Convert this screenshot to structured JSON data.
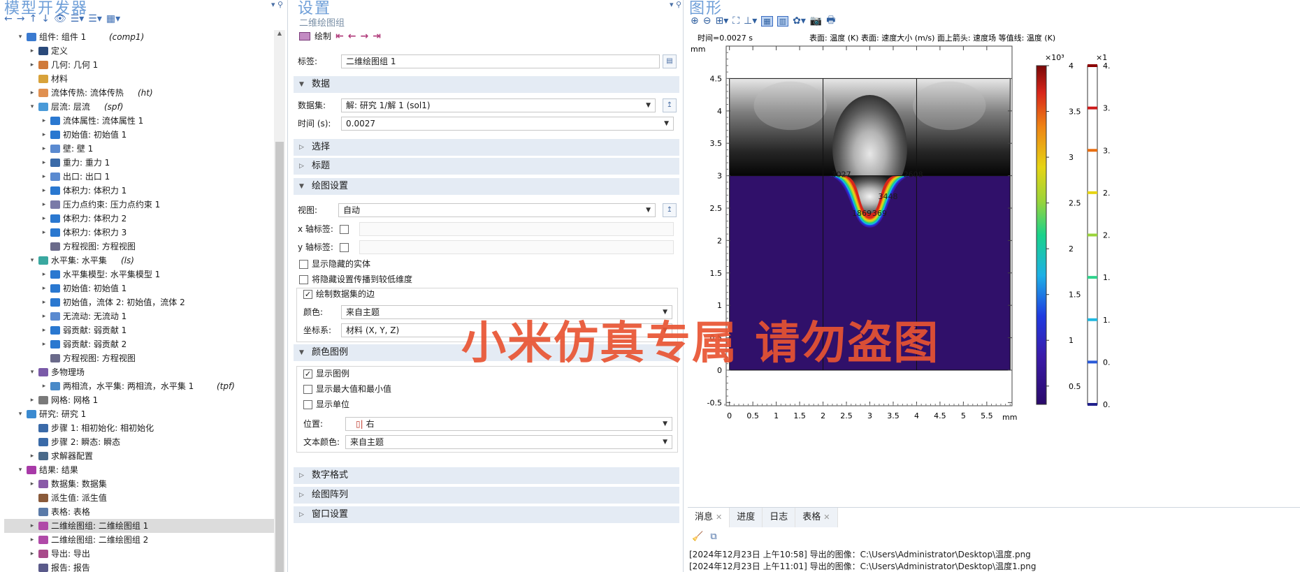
{
  "left": {
    "title": "模型开发器",
    "tree": [
      {
        "indent": 0,
        "arrow": "▾",
        "icon": "component",
        "text": "组件: 组件 1",
        "italic": "(comp1)"
      },
      {
        "indent": 1,
        "arrow": "▸",
        "icon": "definitions",
        "text": "定义",
        "italic": ""
      },
      {
        "indent": 1,
        "arrow": "▸",
        "icon": "geometry",
        "text": "几何: 几何 1",
        "italic": ""
      },
      {
        "indent": 1,
        "arrow": "",
        "icon": "materials",
        "text": "材料",
        "italic": ""
      },
      {
        "indent": 1,
        "arrow": "▸",
        "icon": "heat-transfer",
        "text": "流体传热: 流体传热",
        "italic": "(ht)"
      },
      {
        "indent": 1,
        "arrow": "▾",
        "icon": "laminar-flow",
        "text": "层流: 层流",
        "italic": "(spf)"
      },
      {
        "indent": 2,
        "arrow": "▸",
        "icon": "node-blue",
        "text": "流体属性: 流体属性 1",
        "italic": ""
      },
      {
        "indent": 2,
        "arrow": "▸",
        "icon": "node-blue",
        "text": "初始值: 初始值 1",
        "italic": ""
      },
      {
        "indent": 2,
        "arrow": "▸",
        "icon": "wall",
        "text": "壁: 壁 1",
        "italic": ""
      },
      {
        "indent": 2,
        "arrow": "▸",
        "icon": "gravity",
        "text": "重力: 重力 1",
        "italic": ""
      },
      {
        "indent": 2,
        "arrow": "▸",
        "icon": "outlet",
        "text": "出口: 出口 1",
        "italic": ""
      },
      {
        "indent": 2,
        "arrow": "▸",
        "icon": "node-blue",
        "text": "体积力: 体积力 1",
        "italic": ""
      },
      {
        "indent": 2,
        "arrow": "▸",
        "icon": "pressure",
        "text": "压力点约束: 压力点约束 1",
        "italic": ""
      },
      {
        "indent": 2,
        "arrow": "▸",
        "icon": "node-blue",
        "text": "体积力: 体积力 2",
        "italic": ""
      },
      {
        "indent": 2,
        "arrow": "▸",
        "icon": "node-blue",
        "text": "体积力: 体积力 3",
        "italic": ""
      },
      {
        "indent": 2,
        "arrow": "",
        "icon": "equation",
        "text": "方程视图: 方程视图",
        "italic": ""
      },
      {
        "indent": 1,
        "arrow": "▾",
        "icon": "level-set",
        "text": "水平集: 水平集",
        "italic": "(ls)"
      },
      {
        "indent": 2,
        "arrow": "▸",
        "icon": "node-blue",
        "text": "水平集模型: 水平集模型 1",
        "italic": ""
      },
      {
        "indent": 2,
        "arrow": "▸",
        "icon": "node-blue",
        "text": "初始值: 初始值 1",
        "italic": ""
      },
      {
        "indent": 2,
        "arrow": "▸",
        "icon": "node-blue",
        "text": "初始值，流体 2: 初始值，流体 2",
        "italic": ""
      },
      {
        "indent": 2,
        "arrow": "▸",
        "icon": "wall",
        "text": "无流动: 无流动 1",
        "italic": ""
      },
      {
        "indent": 2,
        "arrow": "▸",
        "icon": "node-blue",
        "text": "弱贡献: 弱贡献 1",
        "italic": ""
      },
      {
        "indent": 2,
        "arrow": "▸",
        "icon": "node-blue",
        "text": "弱贡献: 弱贡献 2",
        "italic": ""
      },
      {
        "indent": 2,
        "arrow": "",
        "icon": "equation",
        "text": "方程视图: 方程视图",
        "italic": ""
      },
      {
        "indent": 1,
        "arrow": "▾",
        "icon": "multiphysics",
        "text": "多物理场",
        "italic": ""
      },
      {
        "indent": 2,
        "arrow": "▸",
        "icon": "two-phase",
        "text": "两相流，水平集: 两相流，水平集 1",
        "italic": "(tpf)"
      },
      {
        "indent": 1,
        "arrow": "▸",
        "icon": "mesh",
        "text": "网格: 网格 1",
        "italic": ""
      },
      {
        "indent": 0,
        "arrow": "▾",
        "icon": "study",
        "text": "研究: 研究 1",
        "italic": ""
      },
      {
        "indent": 1,
        "arrow": "",
        "icon": "step",
        "text": "步骤 1: 相初始化: 相初始化",
        "italic": ""
      },
      {
        "indent": 1,
        "arrow": "",
        "icon": "step",
        "text": "步骤 2: 瞬态: 瞬态",
        "italic": ""
      },
      {
        "indent": 1,
        "arrow": "▸",
        "icon": "solver",
        "text": "求解器配置",
        "italic": ""
      },
      {
        "indent": 0,
        "arrow": "▾",
        "icon": "results",
        "text": "结果: 结果",
        "italic": ""
      },
      {
        "indent": 1,
        "arrow": "▸",
        "icon": "datasets",
        "text": "数据集: 数据集",
        "italic": ""
      },
      {
        "indent": 1,
        "arrow": "",
        "icon": "derived",
        "text": "派生值: 派生值",
        "italic": ""
      },
      {
        "indent": 1,
        "arrow": "",
        "icon": "tables",
        "text": "表格: 表格",
        "italic": ""
      },
      {
        "indent": 1,
        "arrow": "▸",
        "icon": "plot-group",
        "text": "二维绘图组: 二维绘图组 1",
        "italic": "",
        "selected": true
      },
      {
        "indent": 1,
        "arrow": "▸",
        "icon": "plot-group",
        "text": "二维绘图组: 二维绘图组 2",
        "italic": ""
      },
      {
        "indent": 1,
        "arrow": "▸",
        "icon": "export",
        "text": "导出: 导出",
        "italic": ""
      },
      {
        "indent": 1,
        "arrow": "",
        "icon": "report",
        "text": "报告: 报告",
        "italic": ""
      }
    ]
  },
  "settings": {
    "title": "设置",
    "subtitle": "二维绘图组",
    "plot_label": "绘制",
    "label_key": "标签:",
    "label_value": "二维绘图组 1",
    "sections": {
      "data": "数据",
      "selection": "选择",
      "title": "标题",
      "plot_settings": "绘图设置",
      "color_legend": "颜色图例",
      "number_format": "数字格式",
      "plot_array": "绘图阵列",
      "window_settings": "窗口设置"
    },
    "dataset_key": "数据集:",
    "dataset_value": "解: 研究 1/解 1 (sol1)",
    "time_key": "时间 (s):",
    "time_value": "0.0027",
    "view_key": "视图:",
    "view_value": "自动",
    "xlabel_key": "x 轴标签:",
    "ylabel_key": "y 轴标签:",
    "show_hidden": "显示隐藏的实体",
    "propagate_hidden": "将隐藏设置传播到较低维度",
    "plot_edges": "绘制数据集的边",
    "color_key": "颜色:",
    "color_value": "来自主题",
    "frame_key": "坐标系:",
    "frame_value": "材料  (X, Y, Z)",
    "show_legend": "显示图例",
    "show_maxmin": "显示最大值和最小值",
    "show_units": "显示单位",
    "position_key": "位置:",
    "position_value": "右",
    "text_color_key": "文本颜色:",
    "text_color_value": "来自主题"
  },
  "graphics": {
    "title": "图形",
    "header_time": "时间=0.0027 s",
    "header_desc": "表面: 温度 (K)  表面: 速度大小 (m/s)  面上箭头: 速度场  等值线: 温度 (K)",
    "unit_label": "mm",
    "x_unit": "mm",
    "legend1_exp": "×10³",
    "legend1_ticks": [
      0.5,
      1,
      1.5,
      2,
      2.5,
      3,
      3.5,
      4
    ],
    "legend1_range": [
      0.3,
      4.0
    ],
    "legend2_exp": "×1",
    "legend2_ticks_text": [
      "4.",
      "3.",
      "3.",
      "2.",
      "2.",
      "1.",
      "1.",
      "0.",
      "0."
    ],
    "legend2_colors": [
      "#8b0000",
      "#cc1a1a",
      "#e86e10",
      "#e6d414",
      "#9ad43a",
      "#2fd38c",
      "#1fb8e0",
      "#2a5ad8",
      "#20208c"
    ],
    "contour_labels": [
      "3027",
      "2608",
      "3448",
      "1869",
      "369"
    ]
  },
  "chart_data": {
    "type": "heatmap",
    "title": "",
    "xlabel": "mm",
    "ylabel": "mm",
    "xlim": [
      -0.07,
      6.04
    ],
    "ylim": [
      -0.55,
      5.0
    ],
    "x_ticks": [
      0,
      0.5,
      1,
      1.5,
      2,
      2.5,
      3,
      3.5,
      4,
      4.5,
      5,
      5.5
    ],
    "y_ticks": [
      -0.5,
      0,
      0.5,
      1,
      1.5,
      2,
      2.5,
      3,
      3.5,
      4,
      4.5
    ],
    "domain_x": [
      0,
      6
    ],
    "domain_y": [
      0,
      4.5
    ],
    "interface_y": 3,
    "divider_x": [
      2,
      4
    ],
    "melt_pool": {
      "center_x": 3,
      "depth_y": 2.2,
      "left_x": 2.05,
      "right_x": 3.95
    },
    "legend_ticks": [
      0.5,
      1,
      1.5,
      2,
      2.5,
      3,
      3.5,
      4
    ],
    "legend_unit": "×10³"
  },
  "messages": {
    "tabs": [
      "消息",
      "进度",
      "日志",
      "表格"
    ],
    "lines": [
      "[2024年12月23日 上午10:58] 导出的图像：C:\\Users\\Administrator\\Desktop\\温度.png",
      "[2024年12月23日 上午11:01] 导出的图像：C:\\Users\\Administrator\\Desktop\\温度1.png"
    ]
  },
  "watermark": "小米仿真专属 请勿盗图",
  "colors": {
    "accent": "#6f9fd8",
    "section_bg": "#e4ebf4",
    "watermark": "#e85432",
    "substrate": "#30106a"
  }
}
